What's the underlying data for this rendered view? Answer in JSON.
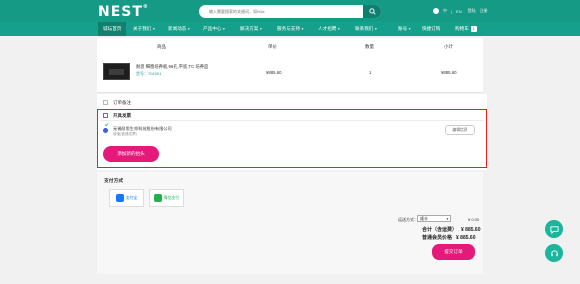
{
  "brand": "NEST",
  "search": {
    "placeholder": "输入需要搜索的关键词，如NVa"
  },
  "top_links": [
    "中",
    "EN",
    "登陆",
    "注册"
  ],
  "nav": {
    "home": "城坛首页",
    "items": [
      "关于我们",
      "新闻动态",
      "产品中心",
      "解决方案",
      "服务与支持",
      "人才招聘",
      "联系我们",
      "账号",
      "快捷订购",
      "购物车"
    ],
    "cart_count": "1"
  },
  "table": {
    "headers": [
      "商品",
      "单价",
      "数量",
      "小计"
    ],
    "rows": [
      {
        "name": "耐思 细胞培养板,96孔,平底,TC 培养皿",
        "code": "货号：701001",
        "price": "¥885.60",
        "qty": "1",
        "subtotal": "¥885.60"
      }
    ]
  },
  "order_note_label": "订单备注",
  "invoice": {
    "label": "开具发票",
    "company": "无锡耐思生命科技股份有限公司",
    "company_sub": "增值(普通发票)",
    "edit_label": "编辑信息",
    "add_label": "添加新的抬头"
  },
  "payment": {
    "title": "支付方式",
    "methods": [
      {
        "name": "支付宝",
        "icon": "alipay-icon",
        "color": "#1677ff"
      },
      {
        "name": "微信支付",
        "icon": "wechat-pay-icon",
        "color": "#22b14c"
      }
    ]
  },
  "summary": {
    "shipping_label": "运送方式：",
    "shipping_option": "顺丰",
    "shipping_fee": "¥ 0.00",
    "total_label": "合计（含运费）",
    "total_value": "¥ 885.60",
    "vip_label": "普通会员价格",
    "vip_value": "¥ 885.60",
    "submit_label": "提交订单"
  },
  "floating": {
    "icons": [
      "chat-icon",
      "headset-icon"
    ]
  },
  "colors": {
    "primary": "#15a08b",
    "accent": "#e5197a",
    "highlight_border": "#e0261c"
  }
}
